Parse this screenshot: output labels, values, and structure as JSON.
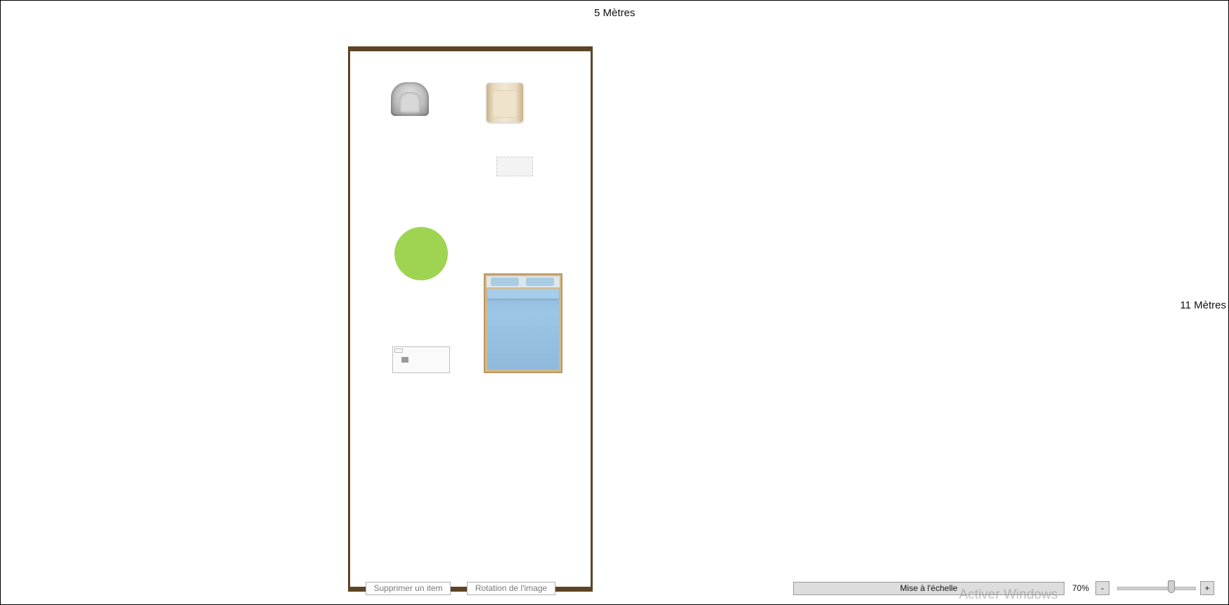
{
  "dimensions": {
    "width_label": "5 Mètres",
    "height_label": "11 Mètres"
  },
  "toolbar": {
    "delete_label": "Supprimer un item",
    "rotate_label": "Rotation de l'image",
    "scale_label": "Mise à l'échelle",
    "zoom_label": "70%",
    "zoom_minus": "-",
    "zoom_plus": "+",
    "zoom_level": 0.7
  },
  "watermark": "Activer Windows",
  "colors": {
    "wall": "#5c4424",
    "rug_green": "#9fd453",
    "blanket": "#8fbadc"
  }
}
